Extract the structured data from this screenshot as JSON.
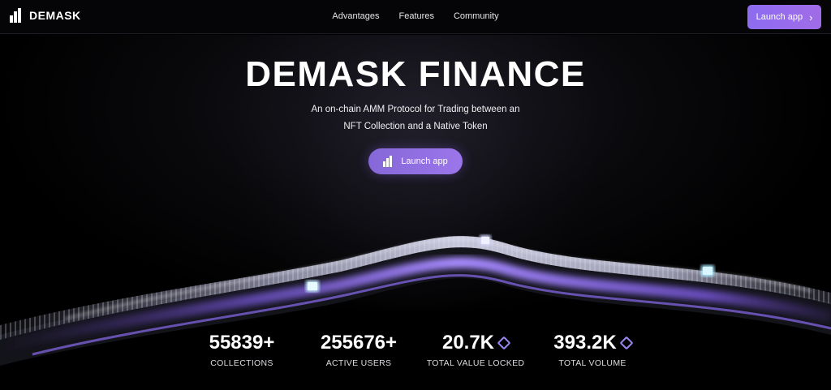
{
  "brand": {
    "name": "DEMASK"
  },
  "nav": {
    "links": [
      "Advantages",
      "Features",
      "Community"
    ],
    "cta_label": "Launch app"
  },
  "hero": {
    "title": "DEMASK FINANCE",
    "subtitle_line1": "An on-chain AMM Protocol for Trading between an",
    "subtitle_line2": "NFT Collection and a Native Token",
    "cta_label": "Launch app"
  },
  "stats": [
    {
      "value": "55839+",
      "label": "COLLECTIONS",
      "icon": ""
    },
    {
      "value": "255676+",
      "label": "ACTIVE USERS",
      "icon": ""
    },
    {
      "value": "20.7K",
      "label": "TOTAL VALUE LOCKED",
      "icon": "diamond-icon"
    },
    {
      "value": "393.2K",
      "label": "TOTAL VOLUME",
      "icon": "diamond-icon"
    }
  ],
  "colors": {
    "accent": "#9b76ea",
    "background": "#000000",
    "diamond": "#9c86f0"
  }
}
